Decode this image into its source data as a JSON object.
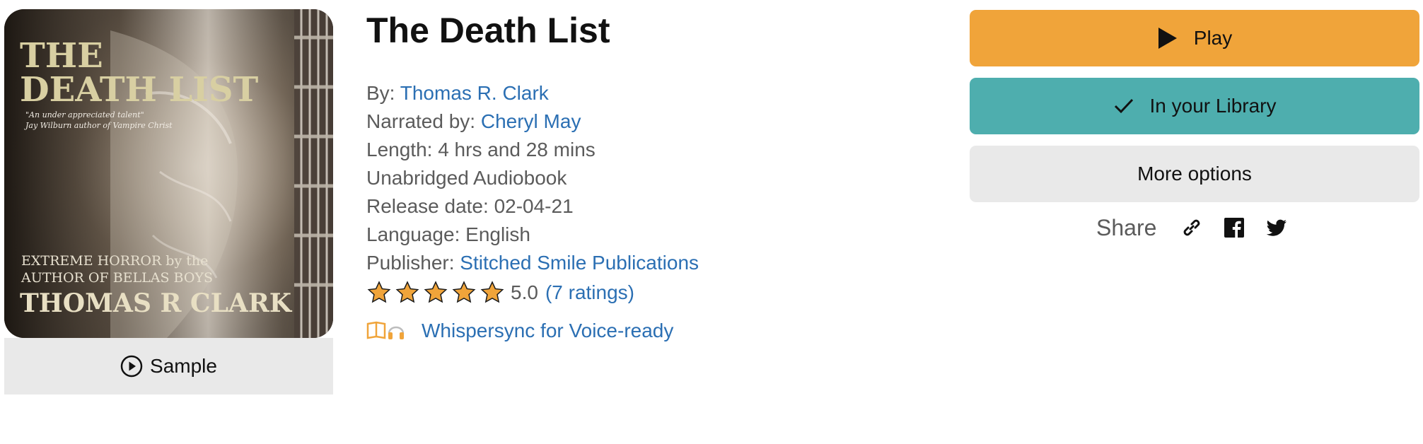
{
  "book": {
    "title": "The Death List",
    "cover": {
      "title_line1": "THE",
      "title_line2": "DEATH LIST",
      "blurb_line1": "\"An under appreciated talent\"",
      "blurb_line2": "Jay Wilburn author of Vampire Christ",
      "tagline_line1": "EXTREME HORROR by the",
      "tagline_line2": "AUTHOR OF BELLAS BOYS",
      "author": "THOMAS R CLARK"
    },
    "sample_label": "Sample"
  },
  "meta": {
    "by_label": "By:",
    "author": "Thomas R. Clark",
    "narrated_label": "Narrated by:",
    "narrator": "Cheryl May",
    "length": "Length: 4 hrs and 28 mins",
    "format": "Unabridged Audiobook",
    "release": "Release date: 02-04-21",
    "language": "Language: English",
    "publisher_label": "Publisher:",
    "publisher": "Stitched Smile Publications"
  },
  "rating": {
    "stars": 5,
    "score": "5.0",
    "count_text": "(7 ratings)"
  },
  "whispersync": {
    "label": "Whispersync for Voice-ready",
    "icon": "book-headphones-icon"
  },
  "actions": {
    "play_label": "Play",
    "library_label": "In your Library",
    "more_label": "More options"
  },
  "share": {
    "label": "Share",
    "icons": [
      "link-icon",
      "facebook-icon",
      "twitter-icon"
    ]
  },
  "colors": {
    "play": "#f0a43a",
    "library": "#4eaeae",
    "link": "#2b6fb3",
    "star": "#f0a43a"
  }
}
